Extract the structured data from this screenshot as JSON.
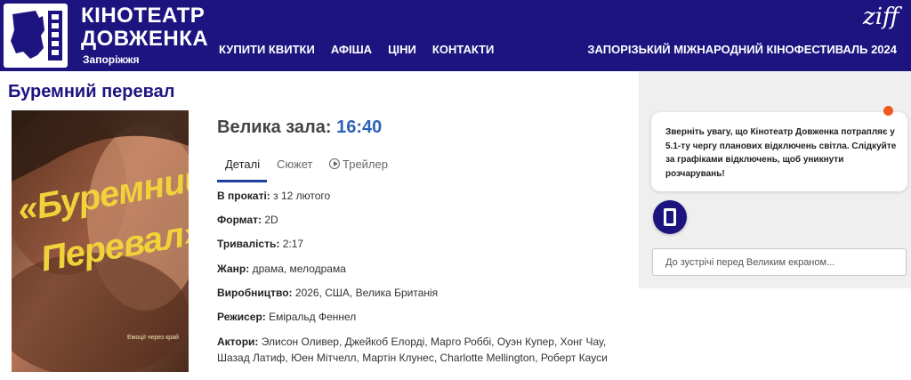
{
  "header": {
    "brand_line1": "КІНОТЕАТР",
    "brand_line2": "ДОВЖЕНКА",
    "brand_city": "Запоріжжя",
    "nav": [
      "КУПИТИ КВИТКИ",
      "АФІША",
      "ЦІНИ",
      "КОНТАКТИ"
    ],
    "festival_logo": "ziff",
    "festival_link": "ЗАПОРІЗЬКИЙ МІЖНАРОДНИЙ КІНОФЕСТИВАЛЬ 2024"
  },
  "movie": {
    "title": "Буремний перевал",
    "poster": {
      "title_line1": "«Буремний",
      "title_line2": "Перевал»",
      "tagline": "Емоції через край"
    },
    "hall_label": "Велика зала:",
    "time": "16:40",
    "tabs": [
      {
        "label": "Деталі",
        "active": true
      },
      {
        "label": "Сюжет",
        "active": false
      },
      {
        "label": "Трейлер",
        "active": false,
        "icon": "play-circle-icon"
      }
    ],
    "details": [
      {
        "label": "В прокаті:",
        "value": "з 12 лютого"
      },
      {
        "label": "Формат:",
        "value": "2D"
      },
      {
        "label": "Тривалість:",
        "value": "2:17"
      },
      {
        "label": "Жанр:",
        "value": "драма, мелодрама"
      },
      {
        "label": "Виробництво:",
        "value": "2026, США, Велика Британія"
      },
      {
        "label": "Режисер:",
        "value": "Еміральд Феннел"
      },
      {
        "label": "Актори:",
        "value": "Элисон Оливер, Джейкоб Елорді, Марго Роббі, Оуэн Купер, Хонг Чау, Шазад Латиф, Юен Мітчелл, Мартін Клунес, Charlotte Mellington, Роберт Кауси"
      }
    ]
  },
  "sidebar": {
    "notice": "Зверніть увагу, що Кінотеатр Довженка потрапляє у 5.1-ту чергу планових відключень світла. Слідкуйте за графіками відключень, щоб уникнути розчарувань!",
    "chat_placeholder": "До зустрічі перед Великим екраном..."
  },
  "colors": {
    "header_bg": "#1d1480",
    "title": "#1d1480",
    "time": "#2c62b8",
    "tab_underline": "#1d3f9c",
    "notice_dot": "#f05a1e",
    "panel_bg": "#efefef"
  }
}
